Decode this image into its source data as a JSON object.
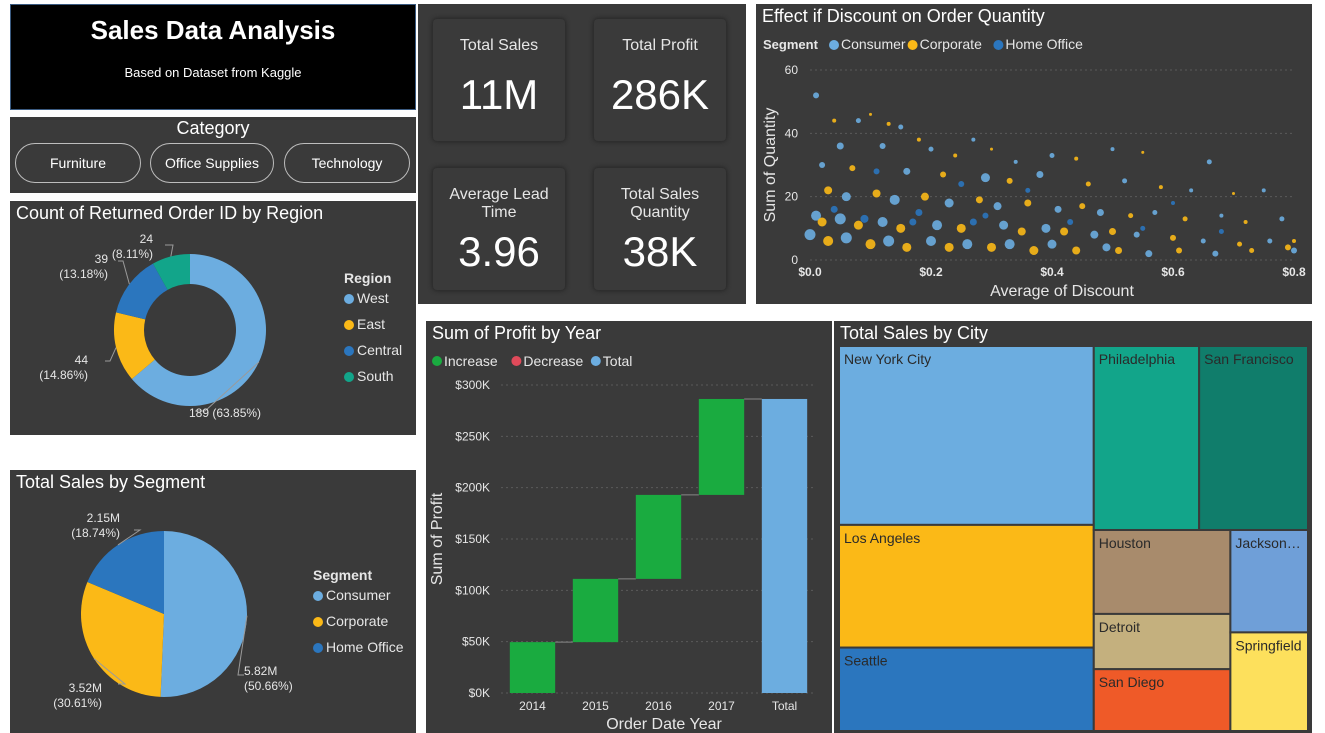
{
  "header": {
    "title": "Sales Data Analysis",
    "subtitle": "Based on Dataset from Kaggle"
  },
  "category_slicer": {
    "title": "Category",
    "options": [
      "Furniture",
      "Office Supplies",
      "Technology"
    ]
  },
  "kpis": {
    "total_sales": {
      "label": "Total Sales",
      "value": "11M"
    },
    "total_profit": {
      "label": "Total Profit",
      "value": "286K"
    },
    "avg_lead_time": {
      "label_line1": "Average Lead",
      "label_line2": "Time",
      "value": "3.96"
    },
    "total_qty": {
      "label_line1": "Total Sales",
      "label_line2": "Quantity",
      "value": "38K"
    }
  },
  "colors": {
    "consumer": "#6cade0",
    "corporate": "#fbb917",
    "home_office": "#2b76be",
    "south": "#12a58a",
    "increase": "#1aab40",
    "decrease": "#e04a5a",
    "total": "#6cade0"
  },
  "chart_data": [
    {
      "id": "returned",
      "type": "pie",
      "title": "Count of Returned Order ID by Region",
      "legend_title": "Region",
      "legend_position": "right",
      "donut": true,
      "slices": [
        {
          "label": "West",
          "value": 189,
          "percent": "63.85%",
          "color": "#6cade0"
        },
        {
          "label": "East",
          "value": 44,
          "percent": "14.86%",
          "color": "#fbb917"
        },
        {
          "label": "Central",
          "value": 39,
          "percent": "13.18%",
          "color": "#2b76be"
        },
        {
          "label": "South",
          "value": 24,
          "percent": "8.11%",
          "color": "#12a58a"
        }
      ]
    },
    {
      "id": "segment",
      "type": "pie",
      "title": "Total Sales by Segment",
      "legend_title": "Segment",
      "legend_position": "right",
      "donut": false,
      "slices": [
        {
          "label": "Consumer",
          "value_label": "5.82M",
          "value": 5.82,
          "percent": "50.66%",
          "color": "#6cade0"
        },
        {
          "label": "Corporate",
          "value_label": "3.52M",
          "value": 3.52,
          "percent": "30.61%",
          "color": "#fbb917"
        },
        {
          "label": "Home Office",
          "value_label": "2.15M",
          "value": 2.15,
          "percent": "18.74%",
          "color": "#2b76be"
        }
      ]
    },
    {
      "id": "discount",
      "type": "scatter",
      "title": "Effect if Discount on Order Quantity",
      "legend_title": "Segment",
      "legend_position": "top-left",
      "series_names": [
        "Consumer",
        "Corporate",
        "Home Office"
      ],
      "xlabel": "Average of Discount",
      "ylabel": "Sum of Quantity",
      "xlim": [
        0,
        0.8
      ],
      "ylim": [
        0,
        60
      ],
      "xticks": [
        "$0.0",
        "$0.2",
        "$0.4",
        "$0.6",
        "$0.8"
      ],
      "yticks": [
        "0",
        "20",
        "40",
        "60"
      ],
      "grid": true,
      "points": [
        [
          0.01,
          52,
          0,
          6
        ],
        [
          0.04,
          44,
          1,
          4
        ],
        [
          0.08,
          44,
          0,
          5
        ],
        [
          0.1,
          46,
          1,
          3
        ],
        [
          0.13,
          43,
          1,
          4
        ],
        [
          0.15,
          42,
          0,
          5
        ],
        [
          0.18,
          38,
          1,
          4
        ],
        [
          0.05,
          36,
          0,
          7
        ],
        [
          0.12,
          36,
          0,
          6
        ],
        [
          0.2,
          35,
          0,
          5
        ],
        [
          0.24,
          33,
          1,
          4
        ],
        [
          0.27,
          38,
          0,
          4
        ],
        [
          0.3,
          35,
          1,
          3
        ],
        [
          0.34,
          31,
          0,
          4
        ],
        [
          0.4,
          33,
          0,
          5
        ],
        [
          0.44,
          32,
          1,
          4
        ],
        [
          0.5,
          35,
          0,
          4
        ],
        [
          0.55,
          34,
          1,
          3
        ],
        [
          0.66,
          31,
          0,
          5
        ],
        [
          0.02,
          30,
          0,
          6
        ],
        [
          0.07,
          29,
          1,
          6
        ],
        [
          0.16,
          28,
          0,
          7
        ],
        [
          0.22,
          27,
          1,
          6
        ],
        [
          0.29,
          26,
          0,
          9
        ],
        [
          0.33,
          25,
          1,
          6
        ],
        [
          0.38,
          27,
          0,
          7
        ],
        [
          0.46,
          24,
          1,
          5
        ],
        [
          0.52,
          25,
          0,
          5
        ],
        [
          0.58,
          23,
          1,
          4
        ],
        [
          0.63,
          22,
          0,
          4
        ],
        [
          0.7,
          21,
          1,
          3
        ],
        [
          0.75,
          22,
          0,
          4
        ],
        [
          0.03,
          22,
          1,
          8
        ],
        [
          0.06,
          20,
          0,
          9
        ],
        [
          0.11,
          21,
          1,
          8
        ],
        [
          0.14,
          19,
          0,
          10
        ],
        [
          0.19,
          20,
          1,
          8
        ],
        [
          0.23,
          18,
          0,
          9
        ],
        [
          0.28,
          19,
          1,
          7
        ],
        [
          0.31,
          17,
          0,
          8
        ],
        [
          0.36,
          18,
          1,
          7
        ],
        [
          0.41,
          16,
          0,
          7
        ],
        [
          0.45,
          17,
          1,
          6
        ],
        [
          0.48,
          15,
          0,
          7
        ],
        [
          0.53,
          14,
          1,
          5
        ],
        [
          0.57,
          15,
          0,
          5
        ],
        [
          0.62,
          13,
          1,
          5
        ],
        [
          0.68,
          14,
          0,
          4
        ],
        [
          0.72,
          12,
          1,
          4
        ],
        [
          0.78,
          13,
          0,
          5
        ],
        [
          0.01,
          14,
          0,
          10
        ],
        [
          0.02,
          12,
          1,
          9
        ],
        [
          0.05,
          13,
          0,
          11
        ],
        [
          0.08,
          11,
          1,
          9
        ],
        [
          0.09,
          13,
          2,
          8
        ],
        [
          0.12,
          12,
          0,
          10
        ],
        [
          0.15,
          10,
          1,
          9
        ],
        [
          0.17,
          12,
          2,
          7
        ],
        [
          0.21,
          11,
          0,
          10
        ],
        [
          0.25,
          10,
          1,
          9
        ],
        [
          0.27,
          12,
          2,
          7
        ],
        [
          0.32,
          11,
          0,
          9
        ],
        [
          0.35,
          9,
          1,
          8
        ],
        [
          0.39,
          10,
          0,
          9
        ],
        [
          0.42,
          9,
          1,
          8
        ],
        [
          0.47,
          8,
          0,
          8
        ],
        [
          0.5,
          9,
          1,
          7
        ],
        [
          0.54,
          8,
          0,
          6
        ],
        [
          0.6,
          7,
          1,
          6
        ],
        [
          0.65,
          6,
          0,
          5
        ],
        [
          0.71,
          5,
          1,
          5
        ],
        [
          0.76,
          6,
          0,
          5
        ],
        [
          0.79,
          4,
          1,
          6
        ],
        [
          0.0,
          8,
          0,
          11
        ],
        [
          0.03,
          6,
          1,
          10
        ],
        [
          0.06,
          7,
          0,
          11
        ],
        [
          0.1,
          5,
          1,
          10
        ],
        [
          0.13,
          6,
          0,
          11
        ],
        [
          0.16,
          4,
          1,
          9
        ],
        [
          0.2,
          6,
          0,
          10
        ],
        [
          0.23,
          4,
          1,
          9
        ],
        [
          0.26,
          5,
          0,
          10
        ],
        [
          0.3,
          4,
          1,
          9
        ],
        [
          0.33,
          5,
          0,
          10
        ],
        [
          0.37,
          3,
          1,
          9
        ],
        [
          0.4,
          5,
          0,
          9
        ],
        [
          0.44,
          3,
          1,
          8
        ],
        [
          0.49,
          4,
          0,
          8
        ],
        [
          0.51,
          3,
          1,
          7
        ],
        [
          0.56,
          2,
          0,
          7
        ],
        [
          0.61,
          3,
          1,
          6
        ],
        [
          0.67,
          2,
          0,
          6
        ],
        [
          0.73,
          3,
          1,
          5
        ],
        [
          0.8,
          3,
          0,
          6
        ],
        [
          0.8,
          6,
          1,
          4
        ],
        [
          0.04,
          16,
          2,
          7
        ],
        [
          0.18,
          15,
          2,
          7
        ],
        [
          0.29,
          14,
          2,
          6
        ],
        [
          0.43,
          12,
          2,
          6
        ],
        [
          0.55,
          10,
          2,
          5
        ],
        [
          0.68,
          9,
          2,
          5
        ],
        [
          0.11,
          28,
          2,
          6
        ],
        [
          0.25,
          24,
          2,
          6
        ],
        [
          0.36,
          22,
          2,
          5
        ],
        [
          0.6,
          18,
          2,
          4
        ]
      ]
    },
    {
      "id": "profit",
      "type": "bar",
      "subtype": "waterfall",
      "title": "Sum of Profit by Year",
      "legend_position": "top-left",
      "legend": [
        "Increase",
        "Decrease",
        "Total"
      ],
      "xlabel": "Order Date Year",
      "ylabel": "Sum of Profit",
      "categories": [
        "2014",
        "2015",
        "2016",
        "2017",
        "Total"
      ],
      "values": [
        49544,
        61619,
        81795,
        93439,
        286397
      ],
      "ylim": [
        0,
        300000
      ],
      "yticks": [
        "$0K",
        "$50K",
        "$100K",
        "$150K",
        "$200K",
        "$250K",
        "$300K"
      ],
      "grid": true
    },
    {
      "id": "city",
      "type": "treemap",
      "title": "Total Sales by City",
      "cells": [
        {
          "label": "New York City",
          "value": 256368,
          "color": "#6cade0"
        },
        {
          "label": "Los Angeles",
          "value": 175851,
          "color": "#fbb917"
        },
        {
          "label": "Seattle",
          "value": 119541,
          "color": "#2b76be"
        },
        {
          "label": "Philadelphia",
          "value": 109077,
          "color": "#12a58a"
        },
        {
          "label": "San Francisco",
          "value": 112669,
          "color": "#107d6b"
        },
        {
          "label": "Houston",
          "value": 64505,
          "color": "#a88b6c"
        },
        {
          "label": "Detroit",
          "value": 42446,
          "color": "#c4b07e"
        },
        {
          "label": "San Diego",
          "value": 47521,
          "color": "#ef5a28"
        },
        {
          "label": "Jackson…",
          "value": 44713,
          "color": "#6f9fd8"
        },
        {
          "label": "Springfield",
          "value": 43054,
          "color": "#fde05c"
        }
      ]
    }
  ]
}
